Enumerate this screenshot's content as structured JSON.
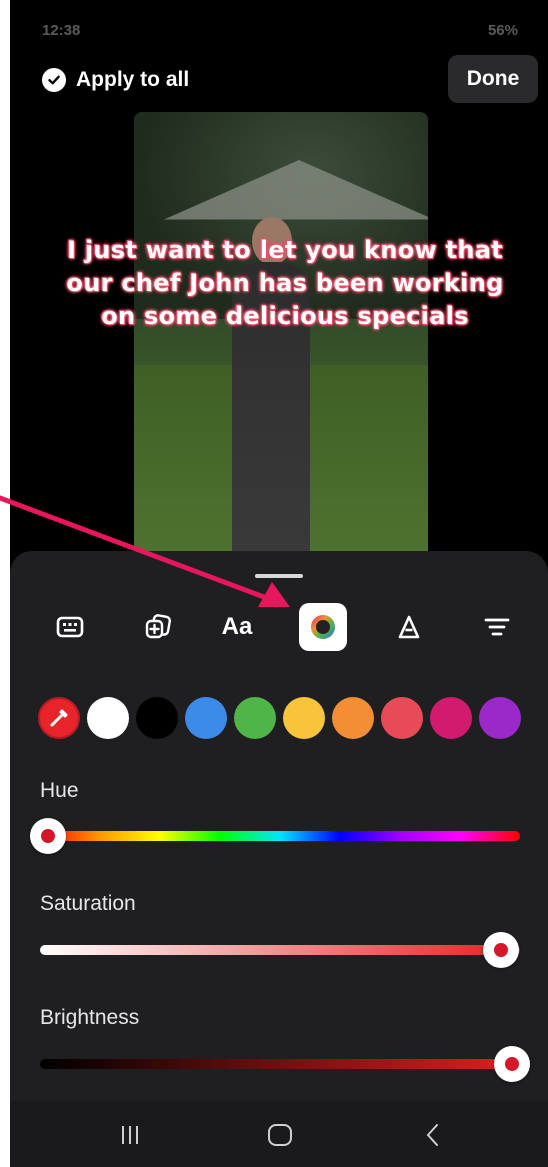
{
  "status": {
    "time": "12:38",
    "battery": "56%"
  },
  "header": {
    "apply_label": "Apply to all",
    "done_label": "Done"
  },
  "caption": {
    "text": "I just want to let you know that our chef John has been working on some delicious specials"
  },
  "toolbar": {
    "items": [
      {
        "icon": "keyboard-icon"
      },
      {
        "icon": "add-sticker-icon"
      },
      {
        "icon": "font-icon",
        "label": "Aa"
      },
      {
        "icon": "color-wheel-icon",
        "active": true
      },
      {
        "icon": "text-style-icon"
      },
      {
        "icon": "align-icon"
      }
    ]
  },
  "swatches": [
    "#e8242b",
    "#ffffff",
    "#000000",
    "#3b8be8",
    "#4fb548",
    "#f7c43a",
    "#f28f35",
    "#e84a57",
    "#d21a6e",
    "#9b28c9"
  ],
  "sliders": {
    "hue": {
      "label": "Hue",
      "value": 0.0
    },
    "saturation": {
      "label": "Saturation",
      "value": 0.96
    },
    "brightness": {
      "label": "Brightness",
      "value": 1.0
    }
  },
  "accent": "#e8175d"
}
